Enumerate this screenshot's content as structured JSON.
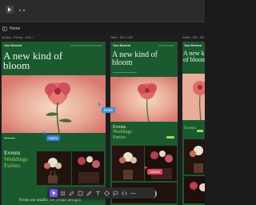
{
  "breadcrumb": {
    "home_label": "Home"
  },
  "frames": [
    {
      "label": "Desktop - Primary · 1440 ×",
      "brand": "Your Moment",
      "hero_title": "A new kind of bloom",
      "events": [
        "Events",
        "Weddings",
        "Parties"
      ],
      "footer": "From our studio, we create designs"
    },
    {
      "label": "Tablet · 820 × 1180",
      "brand": "Your Moment",
      "hero_title": "A new kind of bloom",
      "events": [
        "Events",
        "Weddings",
        "Parties"
      ]
    },
    {
      "label": "Mobile · 390 × 844",
      "brand": "Your Moment",
      "hero_title": "A new kind of bloom",
      "events": [
        "Events"
      ]
    }
  ],
  "cursors": [
    {
      "name": "Robin",
      "color": "#3a8fe0"
    },
    {
      "name": "Maria",
      "color": "#3d7bd6"
    },
    {
      "name": "Ariana",
      "color": "#e04a5a"
    }
  ],
  "toolbar": {
    "tools": [
      "move-tool",
      "frame-tool",
      "pen-tool",
      "shape-tool",
      "text-tool",
      "comment-tool",
      "image-tool",
      "component-tool",
      "more-tool"
    ]
  },
  "colors": {
    "frame_green": "#1a5a2e",
    "accent_green": "#9ad06a",
    "toolbar_active": "#6f56e8",
    "canvas_bg": "#1e1e1e"
  }
}
